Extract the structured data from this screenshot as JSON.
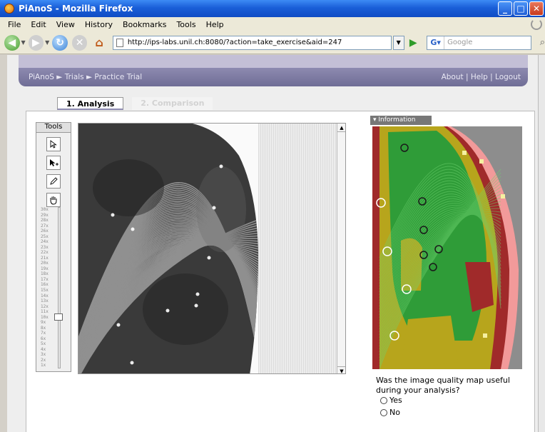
{
  "window": {
    "title": "PiAnoS - Mozilla Firefox",
    "minimize": "_",
    "maximize": "□",
    "close": "✕"
  },
  "menu": [
    "File",
    "Edit",
    "View",
    "History",
    "Bookmarks",
    "Tools",
    "Help"
  ],
  "nav": {
    "url": "http://ips-labs.unil.ch:8080/?action=take_exercise&aid=247",
    "search_placeholder": "Google",
    "back_icon": "arrow-left-icon",
    "forward_icon": "arrow-right-icon",
    "reload_icon": "reload-icon",
    "stop_icon": "stop-icon",
    "home_icon": "home-icon"
  },
  "breadcrumb": {
    "items": [
      "PiAnoS",
      "Trials",
      "Practice Trial"
    ],
    "links": [
      "About",
      "Help",
      "Logout"
    ]
  },
  "tabs": [
    {
      "label": "1. Analysis",
      "active": true
    },
    {
      "label": "2. Comparison",
      "active": false
    }
  ],
  "tools": {
    "title": "Tools",
    "buttons": [
      "pointer-icon",
      "add-point-icon",
      "pencil-icon",
      "hand-icon"
    ],
    "zoom_levels": [
      "30x",
      "29x",
      "28x",
      "27x",
      "26x",
      "25x",
      "24x",
      "23x",
      "22x",
      "21x",
      "20x",
      "19x",
      "18x",
      "17x",
      "16x",
      "15x",
      "14x",
      "13x",
      "12x",
      "11x",
      "10x",
      "9x",
      "8x",
      "7x",
      "6x",
      "5x",
      "4x",
      "3x",
      "2x",
      "1x"
    ],
    "zoom_selected": "10x"
  },
  "info": {
    "tab_label": "Information",
    "question": "Was the image quality map useful during your analysis?",
    "options": [
      "Yes",
      "No"
    ]
  },
  "colors": {
    "breadcrumb_bar": "#7f7ca6",
    "map_green": "#2f9c38",
    "map_yellow": "#b7a51c",
    "map_red": "#a02a2a",
    "map_pink": "#f29a9a"
  }
}
